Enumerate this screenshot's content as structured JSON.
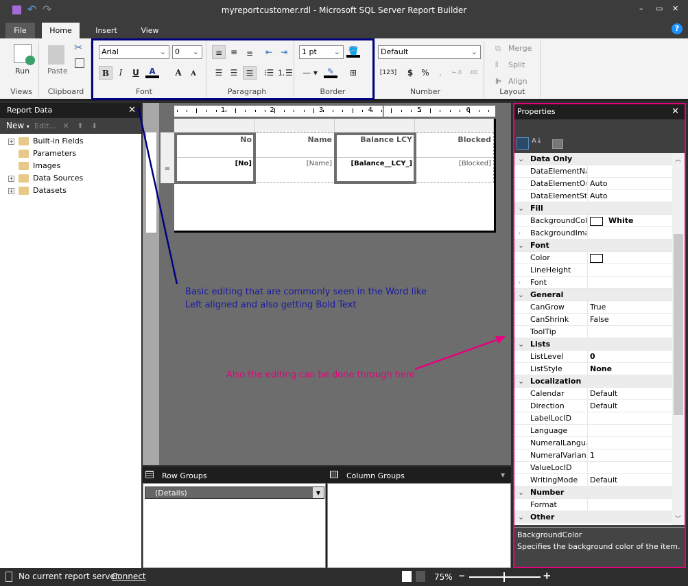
{
  "window": {
    "title": "myreportcustomer.rdl - Microsoft SQL Server Report Builder"
  },
  "tabs": [
    "File",
    "Home",
    "Insert",
    "View"
  ],
  "ribbon": {
    "views": {
      "label": "Views",
      "run": "Run"
    },
    "clipboard": {
      "label": "Clipboard",
      "paste": "Paste"
    },
    "font": {
      "label": "Font",
      "family": "Arial",
      "size": "0"
    },
    "paragraph": {
      "label": "Paragraph"
    },
    "border": {
      "label": "Border",
      "width": "1 pt"
    },
    "number": {
      "label": "Number",
      "format": "Default",
      "placeholders": "[123]",
      "currency": "$",
      "percent": "%",
      "comma": ","
    },
    "layout": {
      "label": "Layout",
      "merge": "Merge",
      "split": "Split",
      "align": "Align"
    }
  },
  "report_data": {
    "title": "Report Data",
    "new": "New",
    "edit": "Edit...",
    "items": [
      {
        "label": "Built-in Fields",
        "expandable": true
      },
      {
        "label": "Parameters",
        "expandable": false
      },
      {
        "label": "Images",
        "expandable": false
      },
      {
        "label": "Data Sources",
        "expandable": true
      },
      {
        "label": "Datasets",
        "expandable": true
      }
    ]
  },
  "ruler": [
    "1",
    "2",
    "3",
    "4",
    "5",
    "6"
  ],
  "table": {
    "headers": [
      "No",
      "Name",
      "Balance LCY",
      "Blocked"
    ],
    "row": [
      "[No]",
      "[Name]",
      "[Balance__LCY_]",
      "[Blocked]"
    ]
  },
  "annotations": {
    "blue": [
      "Basic editing that are commonly seen in the Word like",
      "Left aligned and also getting Bold Text"
    ],
    "pink": "Also the editing can be done through here",
    "blue_color": "#000080",
    "pink_color": "#e6007e"
  },
  "groups": {
    "row_title": "Row Groups",
    "col_title": "Column Groups",
    "details": "(Details)"
  },
  "properties": {
    "title": "Properties",
    "rows": [
      {
        "cat": true,
        "n": "Data Only"
      },
      {
        "n": "DataElementNai",
        "v": ""
      },
      {
        "n": "DataElementOu",
        "v": "Auto"
      },
      {
        "n": "DataElementSty",
        "v": "Auto"
      },
      {
        "cat": true,
        "n": "Fill"
      },
      {
        "n": "BackgroundCol",
        "v": "White",
        "swatch": true,
        "bold": true
      },
      {
        "n": "BackgroundIma",
        "v": "",
        "exp": true
      },
      {
        "cat": true,
        "n": "Font"
      },
      {
        "n": "Color",
        "v": "",
        "swatch": true
      },
      {
        "n": "LineHeight",
        "v": ""
      },
      {
        "n": "Font",
        "v": "",
        "exp": true
      },
      {
        "cat": true,
        "n": "General"
      },
      {
        "n": "CanGrow",
        "v": "True"
      },
      {
        "n": "CanShrink",
        "v": "False"
      },
      {
        "n": "ToolTip",
        "v": ""
      },
      {
        "cat": true,
        "n": "Lists"
      },
      {
        "n": "ListLevel",
        "v": "0",
        "bold": true
      },
      {
        "n": "ListStyle",
        "v": "None",
        "bold": true
      },
      {
        "cat": true,
        "n": "Localization"
      },
      {
        "n": "Calendar",
        "v": "Default"
      },
      {
        "n": "Direction",
        "v": "Default"
      },
      {
        "n": "LabelLocID",
        "v": ""
      },
      {
        "n": "Language",
        "v": ""
      },
      {
        "n": "NumeralLangua",
        "v": ""
      },
      {
        "n": "NumeralVariant",
        "v": "1"
      },
      {
        "n": "ValueLocID",
        "v": ""
      },
      {
        "n": "WritingMode",
        "v": "Default"
      },
      {
        "cat": true,
        "n": "Number"
      },
      {
        "n": "Format",
        "v": ""
      },
      {
        "cat": true,
        "n": "Other"
      }
    ],
    "desc_title": "BackgroundColor",
    "desc": "Specifies the background color of the item."
  },
  "status": {
    "server": "No current report server.",
    "connect": "Connect",
    "zoom": "75%"
  }
}
